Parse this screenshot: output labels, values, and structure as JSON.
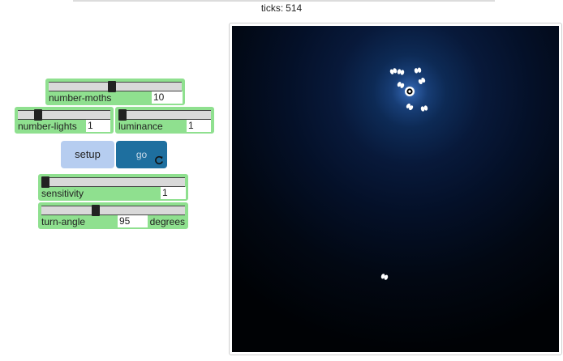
{
  "header": {
    "ticks_label": "ticks:",
    "ticks_value": "514"
  },
  "controls": {
    "number_moths": {
      "label": "number-moths",
      "value": "10",
      "fraction": 0.46
    },
    "number_lights": {
      "label": "number-lights",
      "value": "1",
      "fraction": 0.15
    },
    "luminance": {
      "label": "luminance",
      "value": "1",
      "fraction": 0.0
    },
    "setup": {
      "label": "setup"
    },
    "go": {
      "label": "go",
      "forever_icon": "forever-arrow-icon"
    },
    "sensitivity": {
      "label": "sensitivity",
      "value": "1",
      "fraction": 0.0
    },
    "turn_angle": {
      "label": "turn-angle",
      "value": "95",
      "units": "degrees",
      "fraction": 0.36
    }
  },
  "colors": {
    "slider_green": "#8fe08f",
    "setup_button": "#b6cdf0",
    "go_button": "#1e6f9f",
    "world_background": "#000205",
    "light_glow": "#5d8fd6"
  }
}
